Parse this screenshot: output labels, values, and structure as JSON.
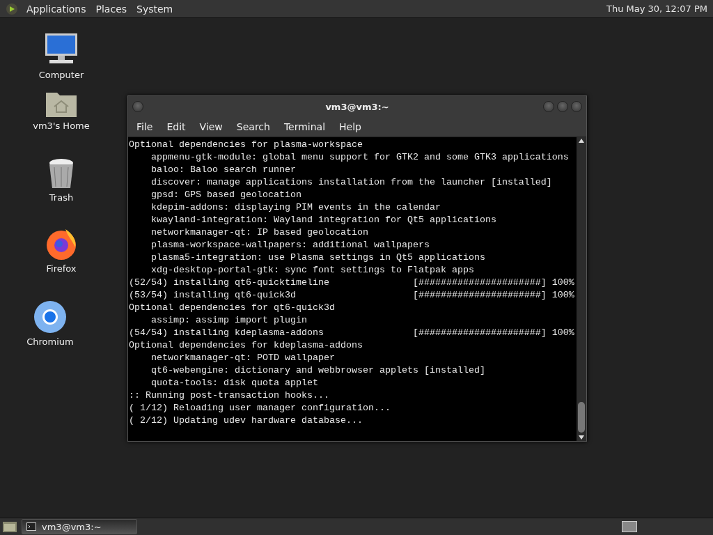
{
  "top_panel": {
    "menus": [
      "Applications",
      "Places",
      "System"
    ],
    "clock": "Thu May 30, 12:07 PM"
  },
  "desktop_icons": [
    {
      "kind": "computer",
      "label": "Computer"
    },
    {
      "kind": "home",
      "label": "vm3's Home"
    },
    {
      "kind": "trash",
      "label": "Trash"
    },
    {
      "kind": "firefox",
      "label": "Firefox"
    },
    {
      "kind": "chromium",
      "label": "Chromium"
    }
  ],
  "terminal": {
    "title": "vm3@vm3:~",
    "menu": [
      "File",
      "Edit",
      "View",
      "Search",
      "Terminal",
      "Help"
    ],
    "lines": [
      "Optional dependencies for plasma-workspace",
      "    appmenu-gtk-module: global menu support for GTK2 and some GTK3 applications",
      "    baloo: Baloo search runner",
      "    discover: manage applications installation from the launcher [installed]",
      "    gpsd: GPS based geolocation",
      "    kdepim-addons: displaying PIM events in the calendar",
      "    kwayland-integration: Wayland integration for Qt5 applications",
      "    networkmanager-qt: IP based geolocation",
      "    plasma-workspace-wallpapers: additional wallpapers",
      "    plasma5-integration: use Plasma settings in Qt5 applications",
      "    xdg-desktop-portal-gtk: sync font settings to Flatpak apps",
      "(52/54) installing qt6-quicktimeline               [######################] 100%",
      "(53/54) installing qt6-quick3d                     [######################] 100%",
      "Optional dependencies for qt6-quick3d",
      "    assimp: assimp import plugin",
      "(54/54) installing kdeplasma-addons                [######################] 100%",
      "Optional dependencies for kdeplasma-addons",
      "    networkmanager-qt: POTD wallpaper",
      "    qt6-webengine: dictionary and webbrowser applets [installed]",
      "    quota-tools: disk quota applet",
      ":: Running post-transaction hooks...",
      "( 1/12) Reloading user manager configuration...",
      "( 2/12) Updating udev hardware database..."
    ]
  },
  "taskbar": {
    "windows": [
      {
        "label": "vm3@vm3:~",
        "selected": true
      }
    ]
  }
}
